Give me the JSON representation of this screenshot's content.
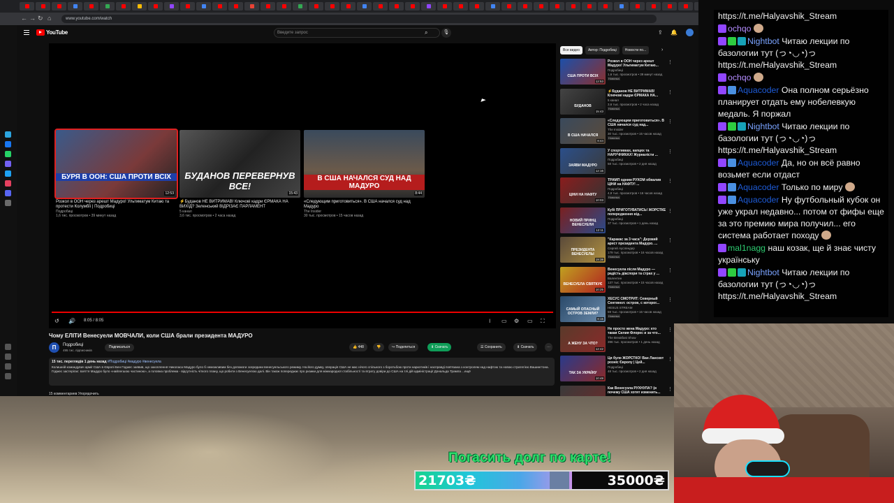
{
  "browser": {
    "url": "www.youtube.com/watch"
  },
  "youtube": {
    "logo_text": "YouTube",
    "search_placeholder": "Введите запрос",
    "video": {
      "title": "Чому ЕЛІТИ Венесуели МОВЧАЛИ, коли США брали президента МАДУРО",
      "time": "8:05 / 8:05",
      "channel": "Подробиці",
      "subscribers": "495 тис. підписників",
      "subscribe_label": "Подписаться",
      "likes": "448",
      "share_label": "Поделиться",
      "download_label": "Скачать",
      "save_label": "Сохранить",
      "clip_label": "Скачать",
      "desc_meta": "15 тис. переглядів  1 день назад ",
      "desc_tags": "#Подробиці #мадуро #венесуела",
      "description": "Колишній командувач армії США в Європі Бен Годжес заявив, що захоплення Николаса Мадуро було б неможливим без допомоги зсередини венесуельського режиму. На його думку, операція США не мас нічого спільного з боротьбою проти наркотиків і насправді пов'язана з контролем над нафтою та новою стратегією Вашингтона. Годжес застерігає: взяття Мадуро було «найлегшою частиною», а головна проблема - відсутність чіткого плану, що робити з Венесуелою далі. Він також попереджає про ризики для міжнародної стабільності та втрату довіри до США на тлі дій адміністрації Дональда Трампа ...ещё",
      "comments_label": "15 комментариев     Упорядочить"
    },
    "endscreen": [
      {
        "title": "Розкол в ООН через арешт Мадуро! Ультиматум Китаю та протести Колумбії | Подробиці",
        "channel": "Подробиці",
        "meta": "1,6 тис. просмотров • 39 минут назад",
        "caption": "БУРЯ В ООН: США ПРОТИ ВСІХ",
        "duration": "12:53"
      },
      {
        "title": "⚡Буданов НЕ ВИТРИМАВ! Ключові кадри ЄРМАКА НА ВИХІД? Зеленський ВІДРІЗАЄ ПАРЛАМЕНТ",
        "channel": "5 канал",
        "meta": "3,6 тис. просмотров • 2 часа назад",
        "caption": "БУДАНОВ ПЕРЕВЕРНУВ ВСЕ!",
        "duration": "15:43"
      },
      {
        "title": "«Следующим приготовиться». В США начался суд над Мадуро",
        "channel": "The Insider",
        "meta": "30 тыс. просмотров • 15 часов назад",
        "caption": "В США НАЧАЛСЯ СУД НАД МАДУРО",
        "duration": "8:44"
      }
    ],
    "chips": [
      "Все видео",
      "Автор: Подробиці",
      "Новости по..."
    ],
    "recommendations": [
      {
        "title": "Розкол в ООН через арешт Мадуро! Ультиматум Китаю...",
        "channel": "Подробиці",
        "meta": "1,6 тыс. просмотров • 39 минут назад",
        "badge": "Новинка",
        "duration": "12:53",
        "caption": "США ПРОТИ ВСІХ"
      },
      {
        "title": "⚡Буданов НЕ ВИТРИМАВ! Ключові кадри ЄРМАКА НА...",
        "channel": "5 канал",
        "meta": "3,6 тыс. просмотров • 2 часа назад",
        "badge": "Новинка",
        "duration": "15:43",
        "caption": "БУДАНОВ"
      },
      {
        "title": "«Следующим приготовиться». В США начался суд над...",
        "channel": "The Insider",
        "meta": "30 тыс. просмотров • 15 часов назад",
        "badge": "Новинка",
        "duration": "8:44",
        "caption": "В США НАЧАЛСЯ"
      },
      {
        "title": "У спортивках, капцях та НАРУЧНИКАХ! Журналісти ...",
        "channel": "Подробиці",
        "meta": "58 тыс. просмотров • 2 дня назад",
        "badge": "",
        "duration": "12:16",
        "caption": "ЗАЯВИ МАДУРО"
      },
      {
        "title": "ТРАМП одним РУХОМ обвалив ЦІНИ на НАФТУ! ...",
        "channel": "Подробиці",
        "meta": "4,8 тыс. просмотров • 16 часов назад",
        "badge": "Новинка",
        "duration": "10:03",
        "caption": "ЦІНИ НА НАФТУ"
      },
      {
        "title": "Кубі ПРИГОТУВАТИСЬ! ЖОРСТКЕ попередження від...",
        "channel": "Подробиці",
        "meta": "37 тыс. просмотров • 1 день назад",
        "badge": "",
        "duration": "12:11",
        "caption": "НОВИЙ ПРИНЦ ВЕНЕСУЕЛИ"
      },
      {
        "title": "\"Каракас за 3 часа\": Дерзкий арест президента Мадуро. ...",
        "channel": "Сергей Ауслендер",
        "meta": "179 тыс. просмотров • 16 часов назад",
        "badge": "Новинка",
        "duration": "19:38",
        "caption": "ПРЕЗИДЕНТА ВЕНЕСУЕЛЫ"
      },
      {
        "title": "Венесуела після Мадуро — радість діаспори та страх у ...",
        "channel": "Валентин",
        "meta": "137 тыс. просмотров • 15 часов назад",
        "badge": "Новинка",
        "duration": "10:25",
        "caption": "ВЕНЕСУЕЛА СВЯТКУЄ"
      },
      {
        "title": "ХЕСУС СМОТРИТ: Северный Сентинел: остров, с которог...",
        "channel": "HESUS STREAM",
        "meta": "59 тыс. просмотров • 16 часов назад",
        "badge": "Новинка",
        "duration": "8:15",
        "caption": "САМЫЙ ОПАСНЫЙ ОСТРОВ ЗЕМЛИ?"
      },
      {
        "title": "Не просто жена Мадуро: кто такая Силия Флорес и за что...",
        "channel": "The Breakfast Show",
        "meta": "396 тыс. просмотров • 1 день назад",
        "badge": "",
        "duration": "12:42",
        "caption": "А ЖЕНУ ЗА ЧТО?"
      },
      {
        "title": "Ця було ЖОРСТКО! Ван Ланскот розніс Європу | Цей...",
        "channel": "Подробиці",
        "meta": "48 тыс. просмотров • 2 дня назад",
        "badge": "",
        "duration": "10:48",
        "caption": "ТАК ЗА УКРАЇНУ"
      },
      {
        "title": "Как Венесуэла РУХНУЛА? (и почему США хотят изменить...",
        "channel": "",
        "meta": "",
        "badge": "",
        "duration": "",
        "caption": ""
      }
    ]
  },
  "chat": [
    {
      "nick": "",
      "text": "https://t.me/Halyavshik_Stream",
      "color": "#f1f1f1",
      "badges": [],
      "emote": false
    },
    {
      "nick": "ochqo",
      "text": "",
      "color": "#b48cff",
      "badges": [
        "#9146ff"
      ],
      "emote": true
    },
    {
      "nick": "Nightbot",
      "text": "Читаю лекции по базологии тут (っ◔◡◔)っ https://t.me/Halyavshik_Stream",
      "color": "#7aa3ff",
      "badges": [
        "#9146ff",
        "#2ecc40",
        "#17a2b8"
      ],
      "emote": false
    },
    {
      "nick": "ochqo",
      "text": "",
      "color": "#b48cff",
      "badges": [
        "#9146ff"
      ],
      "emote": true
    },
    {
      "nick": "Aquacoder",
      "text": "Она полном серьёзно планирует отдать ему нобелевкую медаль. Я поржал",
      "color": "#1e5bd6",
      "badges": [
        "#9146ff",
        "#4a90e2"
      ],
      "emote": false
    },
    {
      "nick": "Nightbot",
      "text": "Читаю лекции по базологии тут (っ◔◡◔)っ https://t.me/Halyavshik_Stream",
      "color": "#7aa3ff",
      "badges": [
        "#9146ff",
        "#2ecc40",
        "#17a2b8"
      ],
      "emote": false
    },
    {
      "nick": "Aquacoder",
      "text": "Да, но он всё равно возьмет если отдаст",
      "color": "#1e5bd6",
      "badges": [
        "#9146ff",
        "#4a90e2"
      ],
      "emote": false
    },
    {
      "nick": "Aquacoder",
      "text": "Только по миру",
      "color": "#1e5bd6",
      "badges": [
        "#9146ff",
        "#4a90e2"
      ],
      "emote": true
    },
    {
      "nick": "Aquacoder",
      "text": "Ну футбольный кубок он уже украл недавно... потом от фифы еще за это премию мира получил... его система работает походу",
      "color": "#1e5bd6",
      "badges": [
        "#9146ff",
        "#4a90e2"
      ],
      "emote": true
    },
    {
      "nick": "mal1nagg",
      "text": "наш козак, ще й знає чисту українську",
      "color": "#2ecc71",
      "badges": [
        "#9146ff"
      ],
      "emote": false
    },
    {
      "nick": "Nightbot",
      "text": "Читаю лекции по базологии тут (っ◔◡◔)っ https://t.me/Halyavshik_Stream",
      "color": "#7aa3ff",
      "badges": [
        "#9146ff",
        "#2ecc40",
        "#17a2b8"
      ],
      "emote": false
    }
  ],
  "stream": {
    "promo_text": "Погасить долг по карте!",
    "goal_current": "21703₴",
    "goal_target": "35000₴",
    "goal_fraction": 0.62
  },
  "colors": {
    "accent_red": "#ff0000",
    "progress_red": "#e00000",
    "promo_green": "#2ee06b"
  }
}
